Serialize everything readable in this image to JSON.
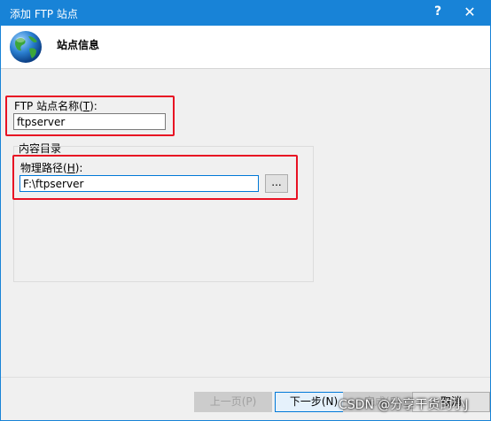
{
  "window": {
    "title": "添加 FTP 站点",
    "help_label": "?",
    "close_label": "✕"
  },
  "header": {
    "title": "站点信息"
  },
  "site_name": {
    "label_prefix": "FTP 站点名称(",
    "label_key": "T",
    "label_suffix": "):",
    "value": "ftpserver"
  },
  "content_dir": {
    "group_label": "内容目录",
    "path_label_prefix": "物理路径(",
    "path_label_key": "H",
    "path_label_suffix": "):",
    "path_value": "F:\\ftpserver",
    "browse_label": "..."
  },
  "footer": {
    "prev_label": "上一页(P)",
    "next_label": "下一步(N)",
    "finish_label": "完成(F)",
    "cancel_label": "取消"
  },
  "watermark": "CSDN @分享干货的小J",
  "colors": {
    "titlebar": "#1883d7",
    "highlight_box": "#e81123"
  }
}
